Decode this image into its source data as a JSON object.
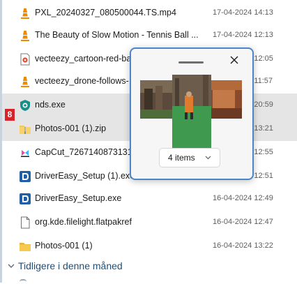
{
  "files": [
    {
      "name": "PXL_20240327_080500044.TS.mp4",
      "date": "17-04-2024 14:13",
      "icon": "vlc-icon"
    },
    {
      "name": "The Beauty of Slow Motion - Tennis Ball ...",
      "date": "17-04-2024 12:13",
      "icon": "vlc-icon"
    },
    {
      "name": "vecteezy_cartoon-red-ba",
      "date": "17-04-2024 12:05",
      "icon": "video-file-icon"
    },
    {
      "name": "vecteezy_drone-follows-",
      "date": "17-04-2024 11:57",
      "icon": "vlc-icon"
    },
    {
      "name": "nds.exe",
      "date": "17-04-2024 20:59",
      "icon": "app-shield-icon"
    },
    {
      "name": "Photos-001 (1).zip",
      "date": "16-04-2024 13:21",
      "icon": "zip-folder-icon"
    },
    {
      "name": "CapCut_72671408731319",
      "date": "16-04-2024 12:55",
      "icon": "capcut-icon"
    },
    {
      "name": "DriverEasy_Setup (1).exe",
      "date": "16-04-2024 12:51",
      "icon": "installer-icon"
    },
    {
      "name": "DriverEasy_Setup.exe",
      "date": "16-04-2024 12:49",
      "icon": "installer-icon"
    },
    {
      "name": "org.kde.filelight.flatpakref",
      "date": "16-04-2024 12:47",
      "icon": "document-icon"
    },
    {
      "name": "Photos-001 (1)",
      "date": "16-04-2024 13:22",
      "icon": "folder-icon"
    }
  ],
  "group_header": "Tidligere i denne måned",
  "badge": "8",
  "popup": {
    "items_label": "4 items"
  },
  "colors": {
    "accent": "#4a86c8",
    "selected_row": "#e5e5e5",
    "badge": "#d6242a",
    "vlc_orange": "#f08a00",
    "folder_yellow": "#f2c94c"
  }
}
